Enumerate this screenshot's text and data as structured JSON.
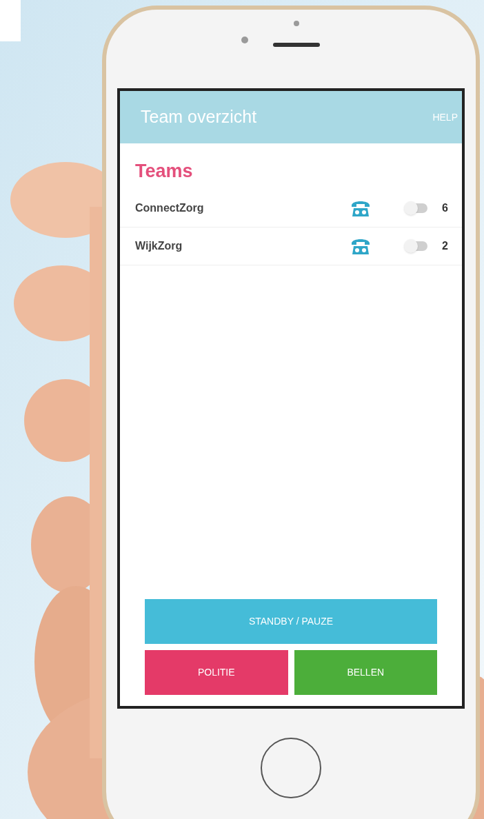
{
  "header": {
    "title": "Team overzicht",
    "help": "HELP"
  },
  "section_title": "Teams",
  "teams": [
    {
      "name": "ConnectZorg",
      "on": false,
      "count": "6"
    },
    {
      "name": "WijkZorg",
      "on": false,
      "count": "2"
    }
  ],
  "buttons": [
    {
      "label": "STANDBY / PAUZE",
      "kind": "standby"
    },
    {
      "label": "POLITIE",
      "kind": "police"
    },
    {
      "label": "BELLEN",
      "kind": "call"
    }
  ]
}
